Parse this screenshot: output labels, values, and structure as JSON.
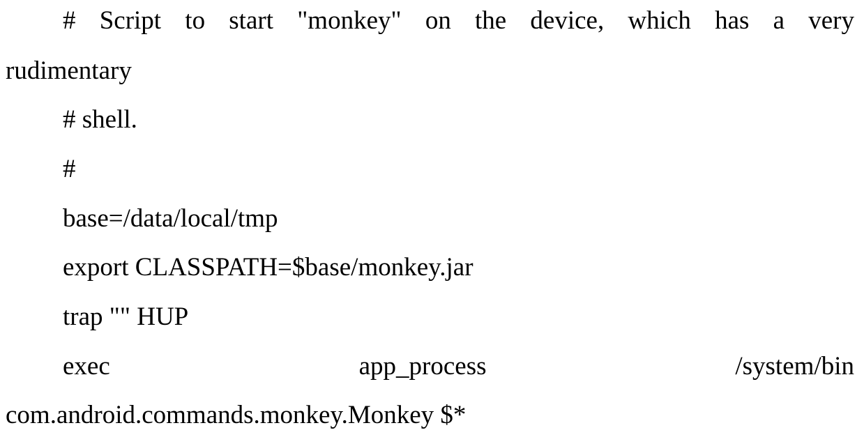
{
  "document": {
    "lines": [
      {
        "words": [
          "#",
          "Script",
          "to",
          "start",
          "\"monkey\"",
          "on",
          "the",
          "device,",
          "which",
          "has",
          "a",
          "very"
        ]
      },
      {
        "text": "rudimentary"
      },
      {
        "text": "# shell."
      },
      {
        "text": "#"
      },
      {
        "text": "base=/data/local/tmp"
      },
      {
        "text": "export CLASSPATH=$base/monkey.jar"
      },
      {
        "text": "trap \"\" HUP"
      },
      {
        "words": [
          "exec",
          "app_process",
          "/system/bin"
        ]
      },
      {
        "text": "com.android.commands.monkey.Monkey $*"
      }
    ]
  }
}
